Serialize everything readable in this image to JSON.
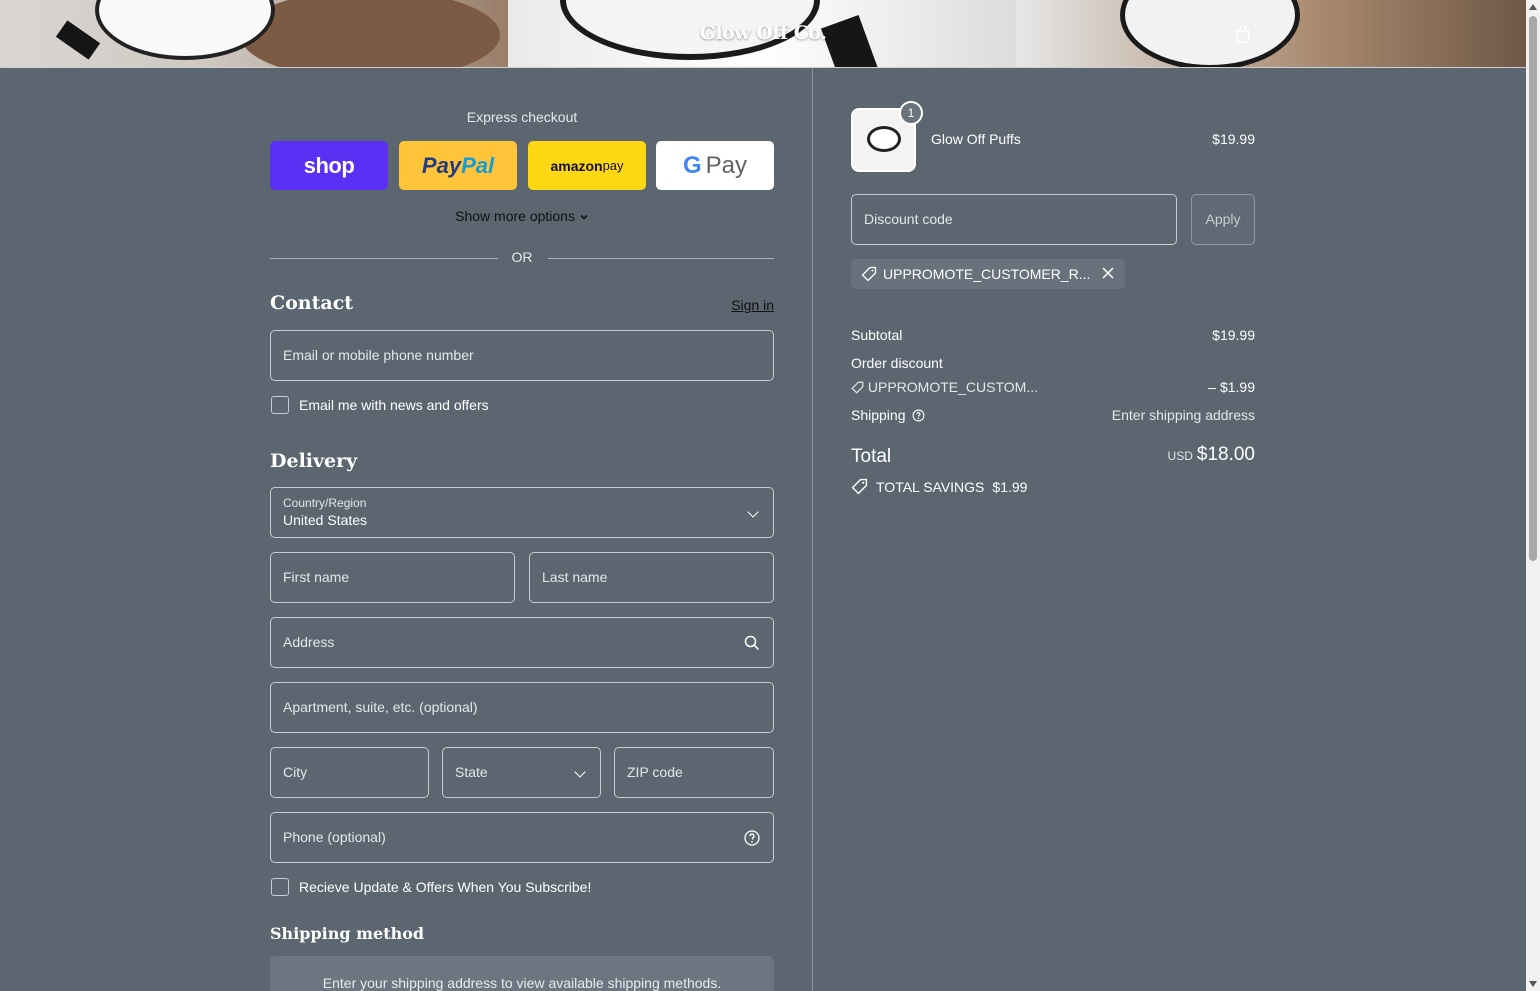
{
  "header": {
    "brand": "Glow Off Co."
  },
  "express": {
    "label": "Express checkout",
    "shop": "shop",
    "paypal_a": "Pay",
    "paypal_b": "Pal",
    "amazon_a": "amazon",
    "amazon_b": " pay",
    "gpay_g": "G",
    "gpay_text": "Pay",
    "more": "Show more options",
    "or": "OR"
  },
  "contact": {
    "heading": "Contact",
    "sign_in": "Sign in",
    "email_placeholder": "Email or mobile phone number",
    "newsletter_label": "Email me with news and offers"
  },
  "delivery": {
    "heading": "Delivery",
    "country_label": "Country/Region",
    "country_value": "United States",
    "first_name": "First name",
    "last_name": "Last name",
    "address": "Address",
    "apartment": "Apartment, suite, etc. (optional)",
    "city": "City",
    "state": "State",
    "zip": "ZIP code",
    "phone": "Phone (optional)",
    "subscribe_label": "Recieve Update & Offers When You Subscribe!"
  },
  "shipping_method": {
    "heading": "Shipping method",
    "notice": "Enter your shipping address to view available shipping methods."
  },
  "summary": {
    "item": {
      "name": "Glow Off Puffs",
      "price": "$19.99",
      "quantity": "1"
    },
    "discount_placeholder": "Discount code",
    "apply": "Apply",
    "applied_code": "UPPROMOTE_CUSTOMER_R...",
    "subtotal_label": "Subtotal",
    "subtotal_value": "$19.99",
    "order_discount_label": "Order discount",
    "order_discount_code": "UPPROMOTE_CUSTOM...",
    "order_discount_value": "– $1.99",
    "shipping_label": "Shipping",
    "shipping_value": "Enter shipping address",
    "total_label": "Total",
    "currency": "USD",
    "total_value": "$18.00",
    "savings_label": "TOTAL SAVINGS",
    "savings_value": "$1.99"
  },
  "colors": {
    "background": "#5b6670",
    "shop": "#5a31f4",
    "paypal": "#ffc439",
    "amazon": "#ffd814"
  }
}
